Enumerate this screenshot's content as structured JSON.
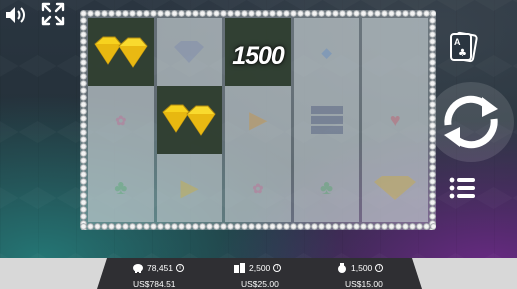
{
  "game": {
    "win_amount": "1500",
    "reels": [
      [
        "diamond",
        "",
        ""
      ],
      [
        "diamond",
        "diamond",
        ""
      ],
      [
        "",
        "",
        ""
      ],
      [
        "",
        "bar",
        ""
      ],
      [
        "",
        "",
        ""
      ]
    ],
    "highlighted_cells": [
      [
        0,
        0
      ],
      [
        1,
        1
      ],
      [
        2,
        0
      ]
    ]
  },
  "controls": {
    "sound": "speaker-icon",
    "fullscreen": "fullscreen-icon",
    "cards": "cards-icon",
    "spin": "spin-icon",
    "menu": "menu-icon"
  },
  "bottom": {
    "balance_credits": "78,451",
    "balance_money": "US$784.51",
    "bet_credits": "2,500",
    "bet_money": "US$25.00",
    "win_credits": "1,500",
    "win_money": "US$15.00"
  },
  "colors": {
    "diamond": "#f7d21e",
    "highlight": "#2c3b2c",
    "bar_bg": "#2b2b2b"
  }
}
